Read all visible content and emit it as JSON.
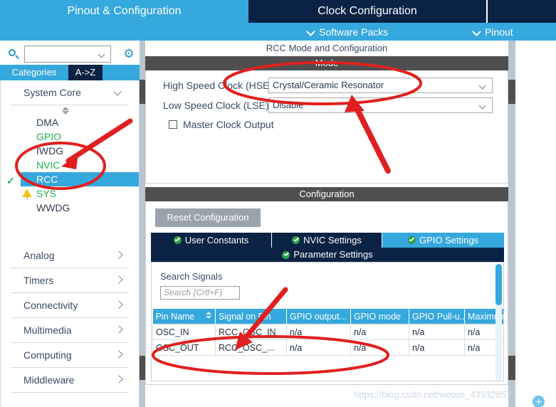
{
  "topbar": {
    "tabs": [
      {
        "label": "Pinout & Configuration",
        "selected": true
      },
      {
        "label": "Clock Configuration",
        "selected": false
      },
      {
        "label": "",
        "selected": false
      }
    ],
    "sub_items": [
      {
        "label": "Software Packs",
        "icon": "chevron-down-icon"
      },
      {
        "label": "Pinout",
        "icon": "chevron-down-icon"
      }
    ]
  },
  "sidebar": {
    "search": {
      "value": "",
      "placeholder": ""
    },
    "gear_icon": "gear-icon",
    "category_tabs": [
      {
        "label": "Categories",
        "selected": true
      },
      {
        "label": "A->Z",
        "selected": false
      }
    ],
    "groups": [
      {
        "label": "System Core",
        "expanded": true
      },
      {
        "label": "Analog",
        "expanded": false
      },
      {
        "label": "Timers",
        "expanded": false
      },
      {
        "label": "Connectivity",
        "expanded": false
      },
      {
        "label": "Multimedia",
        "expanded": false
      },
      {
        "label": "Computing",
        "expanded": false
      },
      {
        "label": "Middleware",
        "expanded": false
      }
    ],
    "system_core_items": [
      {
        "label": "DMA",
        "state": "normal"
      },
      {
        "label": "GPIO",
        "state": "configured"
      },
      {
        "label": "IWDG",
        "state": "normal"
      },
      {
        "label": "NVIC",
        "state": "configured"
      },
      {
        "label": "RCC",
        "state": "selected-checked"
      },
      {
        "label": "SYS",
        "state": "warning"
      },
      {
        "label": "WWDG",
        "state": "normal"
      }
    ]
  },
  "main": {
    "panel_title": "RCC Mode and Configuration",
    "mode": {
      "band_label": "Mode",
      "rows": [
        {
          "label": "High Speed Clock (HSE)",
          "value": "Crystal/Ceramic Resonator"
        },
        {
          "label": "Low Speed Clock (LSE)",
          "value": "Disable"
        }
      ],
      "checkbox": {
        "label": "Master Clock Output",
        "checked": false
      }
    },
    "configuration": {
      "band_label": "Configuration",
      "reset_label": "Reset Configuration",
      "tabs_row1": [
        {
          "label": "User Constants",
          "active": false,
          "icon": "check-circle-icon"
        },
        {
          "label": "NVIC Settings",
          "active": false,
          "icon": "check-circle-icon"
        },
        {
          "label": "GPIO Settings",
          "active": true,
          "icon": "check-circle-icon"
        }
      ],
      "tabs_row2": [
        {
          "label": "Parameter Settings",
          "active": false,
          "icon": "check-circle-icon"
        }
      ],
      "search_signals": {
        "label": "Search Signals",
        "value": "",
        "placeholder": "Search (Crtl+F)"
      },
      "table": {
        "columns": [
          "Pin Name",
          "Signal on Pin",
          "GPIO output...",
          "GPIO mode",
          "GPIO Pull-u...",
          "Maximum"
        ],
        "sorted_column": "Pin Name",
        "rows": [
          [
            "OSC_IN",
            "RCC_OSC_IN",
            "n/a",
            "n/a",
            "n/a",
            "n/a"
          ],
          [
            "OSC_OUT",
            "RCC_OSC_...",
            "n/a",
            "n/a",
            "n/a",
            "n/a"
          ]
        ]
      }
    }
  },
  "watermark": "https://blog.csdn.net/weixin_43932857",
  "colors": {
    "accent_blue": "#35a8dd",
    "dark_navy": "#0a2344",
    "band_gray": "#4f4f4f",
    "green": "#22b14c",
    "annotation_red": "#e02020",
    "warning_yellow": "#f5c518"
  }
}
